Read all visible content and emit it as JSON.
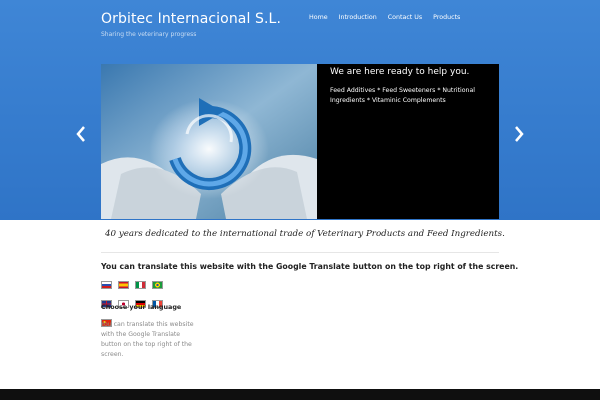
{
  "site": {
    "title": "Orbitec Internacional S.L.",
    "tagline": "Sharing the veterinary progress"
  },
  "nav": {
    "items": [
      "Home",
      "Introduction",
      "Contact Us",
      "Products"
    ]
  },
  "slider": {
    "caption_title": "We are here ready to help you.",
    "caption_text": "Feed Additives * Feed Sweeteners * Nutritional Ingredients * Vitaminic Complements",
    "prev_icon": "chevron-left-icon",
    "next_icon": "chevron-right-icon"
  },
  "main": {
    "mission": "40 years dedicated to the international trade of Veterinary Products and Feed Ingredients.",
    "translate_heading": "You can translate this website with the Google Translate button on the top right of the screen.",
    "choose_language": "Choose your language",
    "translate_note": "You can translate this website with the Google Translate button on the top right of the screen."
  },
  "flags": [
    "Russian",
    "Spanish",
    "Italian",
    "Portuguese",
    "English",
    "Japanese",
    "German",
    "French",
    "Chinese"
  ],
  "colors": {
    "header_blue": "#3f86d6",
    "footer": "#0f0f0f",
    "caption_bg": "#000000"
  }
}
